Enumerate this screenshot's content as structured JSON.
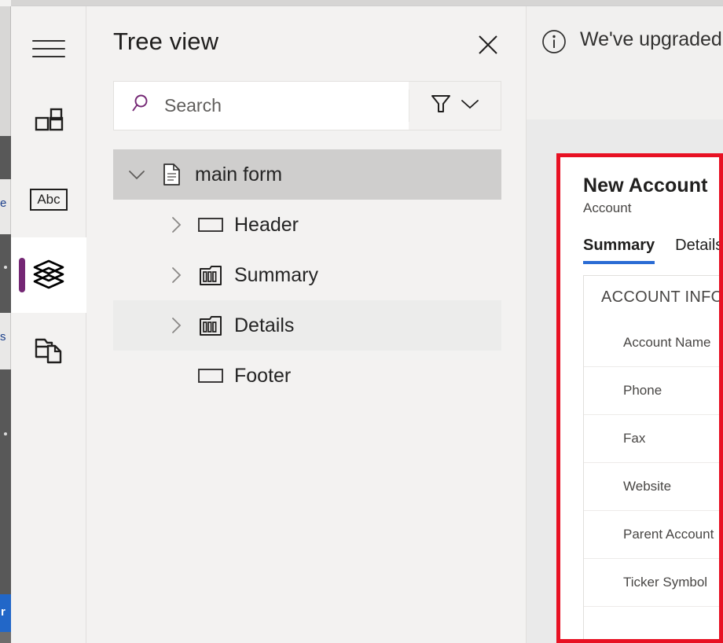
{
  "app": {
    "rail": {
      "items": [
        {
          "icon": "hamburger-menu-icon",
          "name": "menu",
          "selected": false
        },
        {
          "icon": "components-grid-icon",
          "name": "components",
          "selected": false
        },
        {
          "icon": "abc-text-icon",
          "name": "text",
          "label": "Abc",
          "selected": false
        },
        {
          "icon": "layers-icon",
          "name": "layers",
          "selected": true
        },
        {
          "icon": "copy-folder-icon",
          "name": "copy",
          "selected": false
        }
      ]
    }
  },
  "tree_panel": {
    "title": "Tree view",
    "close_icon": "close-icon",
    "search": {
      "placeholder": "Search",
      "value": "",
      "icon": "search-icon"
    },
    "filter": {
      "icon": "filter-funnel-icon",
      "chevron": "chevron-down-icon"
    },
    "items": [
      {
        "label": "main form",
        "icon": "document-icon",
        "chevron": "chevron-down-icon",
        "level": 0,
        "state": "selected"
      },
      {
        "label": "Header",
        "icon": "rectangle-section-icon",
        "chevron": "chevron-right-icon",
        "level": 1,
        "state": "normal"
      },
      {
        "label": "Summary",
        "icon": "tab-columns-icon",
        "chevron": "chevron-right-icon",
        "level": 1,
        "state": "normal"
      },
      {
        "label": "Details",
        "icon": "tab-columns-icon",
        "chevron": "chevron-right-icon",
        "level": 1,
        "state": "hover"
      },
      {
        "label": "Footer",
        "icon": "rectangle-section-icon",
        "chevron": "",
        "level": 1,
        "state": "normal"
      }
    ]
  },
  "canvas": {
    "infobar": {
      "icon": "info-icon",
      "message": "We've upgraded"
    }
  },
  "form_preview": {
    "title": "New Account",
    "subtitle": "Account",
    "tabs": [
      {
        "label": "Summary",
        "active": true
      },
      {
        "label": "Details",
        "active": false
      }
    ],
    "section_header": "ACCOUNT INFOR",
    "fields": [
      "Account Name",
      "Phone",
      "Fax",
      "Website",
      "Parent Account",
      "Ticker Symbol"
    ]
  },
  "edge_strip": {
    "glyph_top": "e",
    "glyph_mid": "s",
    "button_label": "r"
  },
  "colors": {
    "accent_purple": "#742774",
    "annotation_red": "#e81123",
    "tab_underline_blue": "#2b6cd4",
    "panel_bg": "#f3f2f1",
    "selected_row": "#cfcecd"
  }
}
